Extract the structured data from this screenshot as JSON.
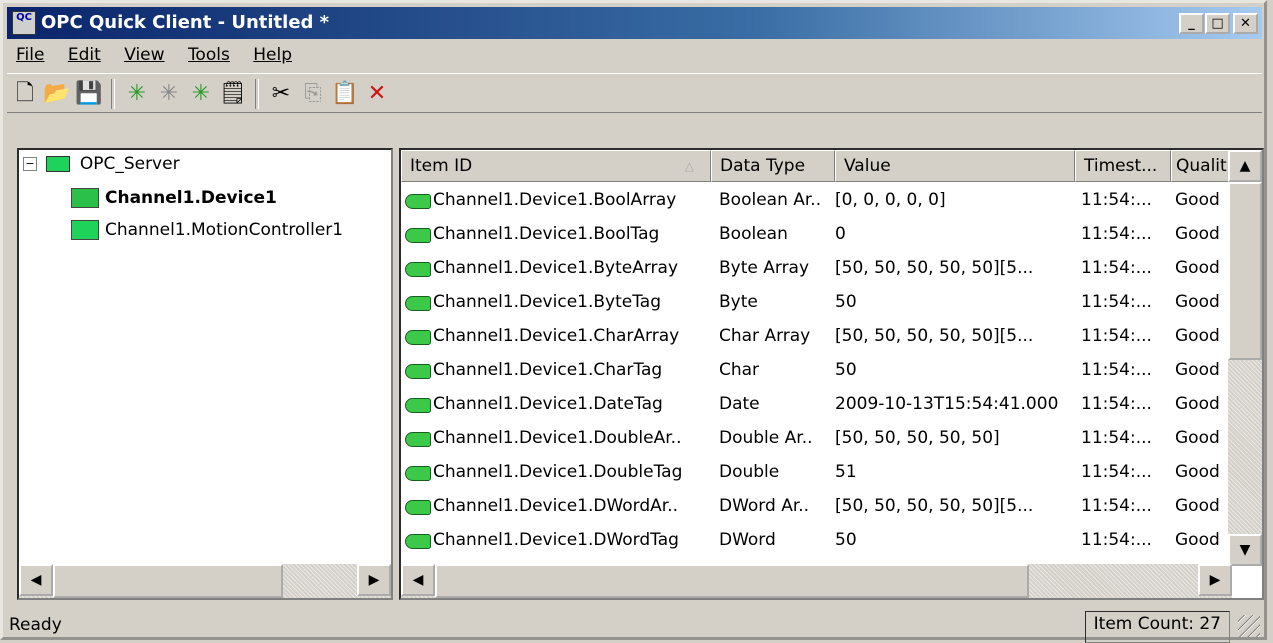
{
  "window": {
    "title": "OPC Quick Client - Untitled *",
    "app_icon_text": "QC"
  },
  "menu": [
    "File",
    "Edit",
    "View",
    "Tools",
    "Help"
  ],
  "tree": {
    "root": "OPC_Server",
    "children": [
      "Channel1.Device1",
      "Channel1.MotionController1"
    ],
    "selected": "Channel1.Device1"
  },
  "list": {
    "columns": [
      "Item ID",
      "Data Type",
      "Value",
      "Timest...",
      "Qualit"
    ],
    "rows": [
      {
        "item_id": "Channel1.Device1.BoolArray",
        "data_type": "Boolean Ar..",
        "value": "[0, 0, 0, 0, 0]",
        "timestamp": "11:54:...",
        "quality": "Good"
      },
      {
        "item_id": "Channel1.Device1.BoolTag",
        "data_type": "Boolean",
        "value": "0",
        "timestamp": "11:54:...",
        "quality": "Good"
      },
      {
        "item_id": "Channel1.Device1.ByteArray",
        "data_type": "Byte Array",
        "value": "[50, 50, 50, 50, 50][5...",
        "timestamp": "11:54:...",
        "quality": "Good"
      },
      {
        "item_id": "Channel1.Device1.ByteTag",
        "data_type": "Byte",
        "value": "50",
        "timestamp": "11:54:...",
        "quality": "Good"
      },
      {
        "item_id": "Channel1.Device1.CharArray",
        "data_type": "Char Array",
        "value": "[50, 50, 50, 50, 50][5...",
        "timestamp": "11:54:...",
        "quality": "Good"
      },
      {
        "item_id": "Channel1.Device1.CharTag",
        "data_type": "Char",
        "value": "50",
        "timestamp": "11:54:...",
        "quality": "Good"
      },
      {
        "item_id": "Channel1.Device1.DateTag",
        "data_type": "Date",
        "value": "2009-10-13T15:54:41.000",
        "timestamp": "11:54:...",
        "quality": "Good"
      },
      {
        "item_id": "Channel1.Device1.DoubleAr..",
        "data_type": "Double Ar..",
        "value": "[50, 50, 50, 50, 50]",
        "timestamp": "11:54:...",
        "quality": "Good"
      },
      {
        "item_id": "Channel1.Device1.DoubleTag",
        "data_type": "Double",
        "value": "51",
        "timestamp": "11:54:...",
        "quality": "Good"
      },
      {
        "item_id": "Channel1.Device1.DWordAr..",
        "data_type": "DWord Ar..",
        "value": "[50, 50, 50, 50, 50][5...",
        "timestamp": "11:54:...",
        "quality": "Good"
      },
      {
        "item_id": "Channel1.Device1.DWordTag",
        "data_type": "DWord",
        "value": "50",
        "timestamp": "11:54:...",
        "quality": "Good"
      }
    ]
  },
  "status": {
    "left": "Ready",
    "right": "Item Count: 27"
  }
}
